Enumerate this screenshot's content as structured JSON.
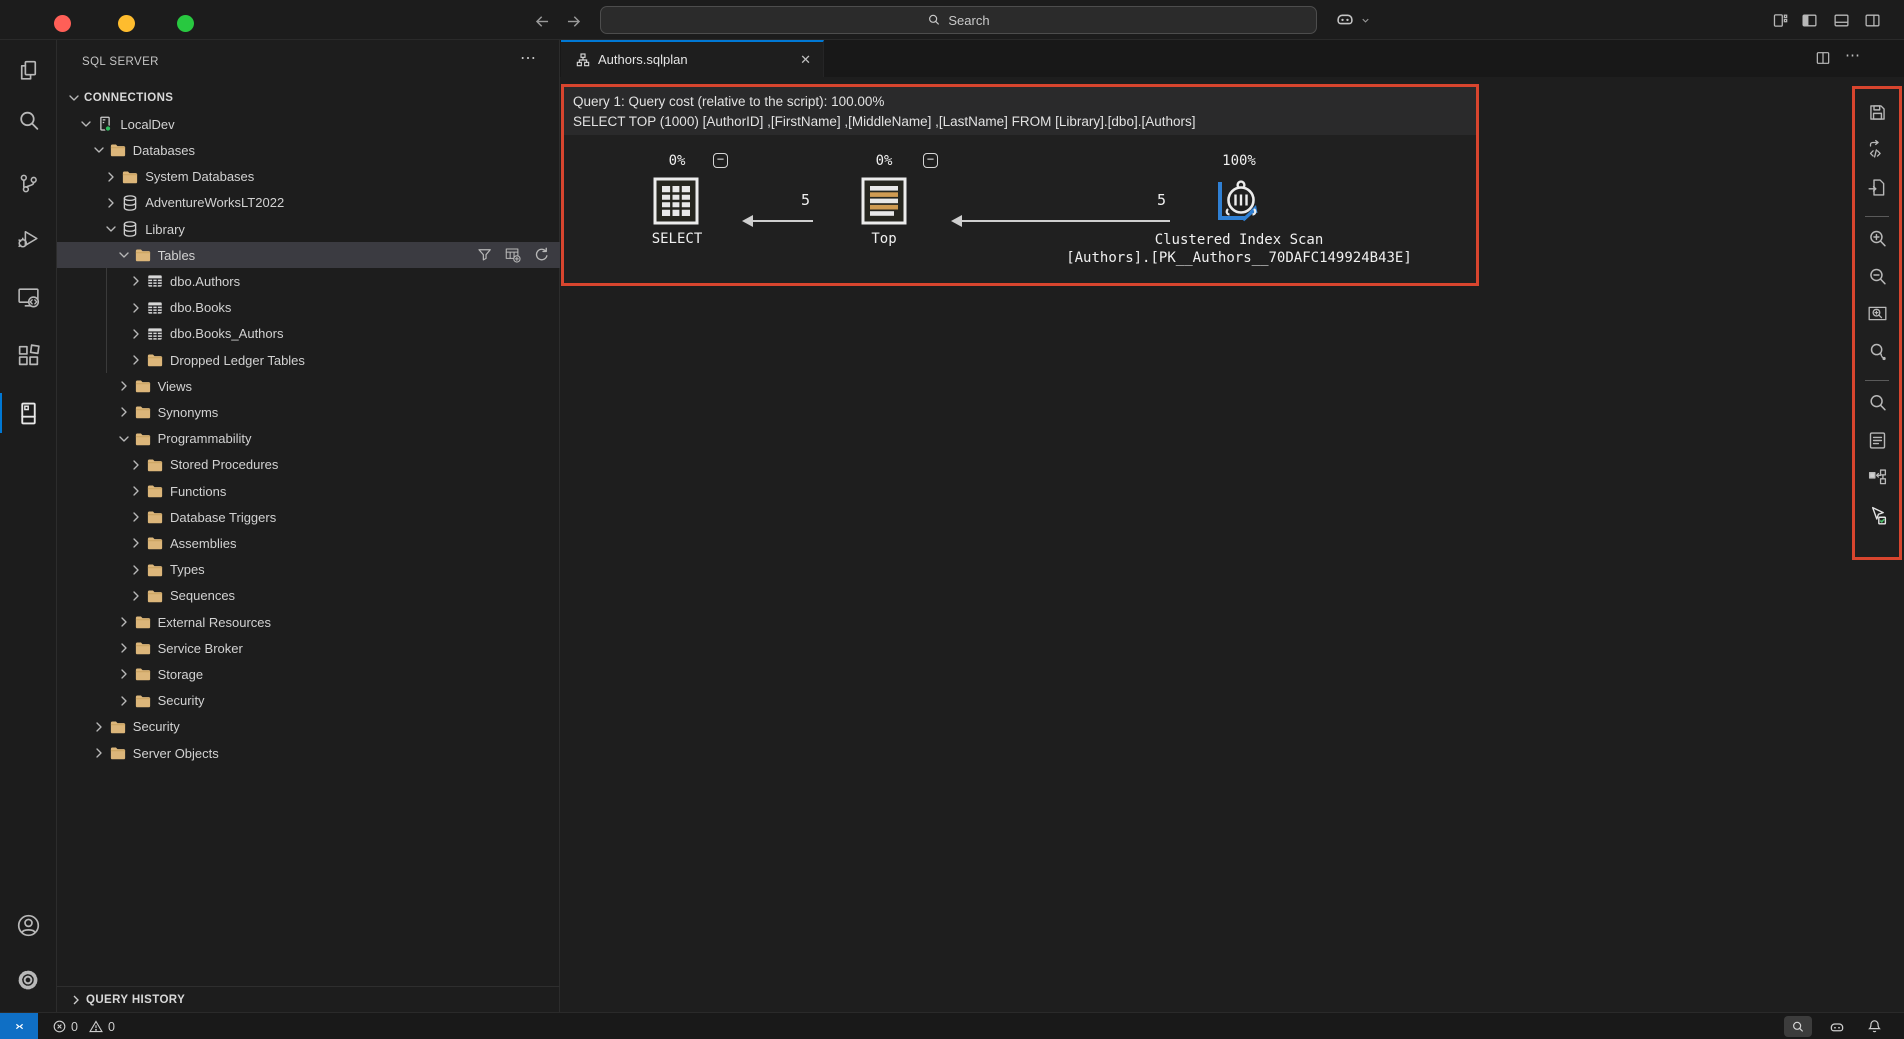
{
  "titlebar": {
    "search_placeholder": "Search",
    "traffic_lights": [
      "close",
      "minimize",
      "zoom"
    ],
    "right_icons": [
      "customize-layout",
      "toggle-primary-sidebar",
      "toggle-panel",
      "toggle-secondary-sidebar"
    ],
    "copilot_menu": "copilot"
  },
  "activity_bar": {
    "items": [
      "explorer",
      "search",
      "source-control",
      "run-and-debug",
      "remote-explorer",
      "extensions",
      "sql-server"
    ],
    "active_item": "sql-server",
    "bottom_items": [
      "accounts",
      "settings"
    ]
  },
  "sidebar": {
    "title": "SQL SERVER",
    "more_label": "⋯",
    "connections_header": "CONNECTIONS",
    "query_history_header": "QUERY HISTORY",
    "tree": [
      {
        "label": "CONNECTIONS",
        "level": 0,
        "chevron": "down",
        "icon": "",
        "header": true
      },
      {
        "label": "LocalDev",
        "level": 1,
        "chevron": "down",
        "icon": "server"
      },
      {
        "label": "Databases",
        "level": 2,
        "chevron": "down",
        "icon": "folder"
      },
      {
        "label": "System Databases",
        "level": 3,
        "chevron": "right",
        "icon": "folder"
      },
      {
        "label": "AdventureWorksLT2022",
        "level": 3,
        "chevron": "right",
        "icon": "database"
      },
      {
        "label": "Library",
        "level": 3,
        "chevron": "down",
        "icon": "database"
      },
      {
        "label": "Tables",
        "level": 4,
        "chevron": "down",
        "icon": "folder",
        "selected": true,
        "actions": [
          "filter",
          "design",
          "refresh"
        ]
      },
      {
        "label": "dbo.Authors",
        "level": 5,
        "chevron": "right",
        "icon": "table"
      },
      {
        "label": "dbo.Books",
        "level": 5,
        "chevron": "right",
        "icon": "table"
      },
      {
        "label": "dbo.Books_Authors",
        "level": 5,
        "chevron": "right",
        "icon": "table"
      },
      {
        "label": "Dropped Ledger Tables",
        "level": 5,
        "chevron": "right",
        "icon": "folder"
      },
      {
        "label": "Views",
        "level": 4,
        "chevron": "right",
        "icon": "folder"
      },
      {
        "label": "Synonyms",
        "level": 4,
        "chevron": "right",
        "icon": "folder"
      },
      {
        "label": "Programmability",
        "level": 4,
        "chevron": "down",
        "icon": "folder"
      },
      {
        "label": "Stored Procedures",
        "level": 5,
        "chevron": "right",
        "icon": "folder"
      },
      {
        "label": "Functions",
        "level": 5,
        "chevron": "right",
        "icon": "folder"
      },
      {
        "label": "Database Triggers",
        "level": 5,
        "chevron": "right",
        "icon": "folder"
      },
      {
        "label": "Assemblies",
        "level": 5,
        "chevron": "right",
        "icon": "folder"
      },
      {
        "label": "Types",
        "level": 5,
        "chevron": "right",
        "icon": "folder"
      },
      {
        "label": "Sequences",
        "level": 5,
        "chevron": "right",
        "icon": "folder"
      },
      {
        "label": "External Resources",
        "level": 4,
        "chevron": "right",
        "icon": "folder"
      },
      {
        "label": "Service Broker",
        "level": 4,
        "chevron": "right",
        "icon": "folder"
      },
      {
        "label": "Storage",
        "level": 4,
        "chevron": "right",
        "icon": "folder"
      },
      {
        "label": "Security",
        "level": 4,
        "chevron": "right",
        "icon": "folder"
      },
      {
        "label": "Security",
        "level": 2,
        "chevron": "right",
        "icon": "folder"
      },
      {
        "label": "Server Objects",
        "level": 2,
        "chevron": "right",
        "icon": "folder"
      }
    ]
  },
  "editor": {
    "tab": {
      "label": "Authors.sqlplan",
      "icon": "sqlplan-icon",
      "close": "✕"
    },
    "tabbar_actions": [
      "split-editor",
      "more-actions"
    ],
    "more_actions_label": "⋯"
  },
  "plan": {
    "header_line1": "Query 1: Query cost (relative to the script): 100.00%",
    "header_line2": "SELECT TOP (1000) [AuthorID] ,[FirstName] ,[MiddleName] ,[LastName] FROM [Library].[dbo].[Authors]",
    "nodes": [
      {
        "cost": "0%",
        "name": "SELECT",
        "collapse": "−"
      },
      {
        "cost": "0%",
        "name": "Top",
        "collapse": "−"
      },
      {
        "cost": "100%",
        "name": "Clustered Index Scan",
        "detail": "[Authors].[PK__Authors__70DAFC149924B43E]"
      }
    ],
    "edges": [
      {
        "rows": "5"
      },
      {
        "rows": "5"
      }
    ],
    "toolbar": [
      "save-plan",
      "show-query-xml",
      "open-query",
      "divider",
      "zoom-in",
      "zoom-out",
      "zoom-to-fit",
      "custom-zoom",
      "divider",
      "find-node",
      "properties",
      "highlight-expensive-operation",
      "toggle-tooltips"
    ]
  },
  "statusbar": {
    "errors": "0",
    "warnings": "0",
    "right_icons": [
      "search",
      "copilot",
      "bell"
    ]
  },
  "colors": {
    "highlight_red": "#d8452e",
    "accent_blue": "#0078d4",
    "remote_blue": "#0f6fc5",
    "folder_tan": "#dcb67a",
    "top_node_bar": "#cf9b52",
    "scan_blue": "#2f80d4",
    "server_green": "#2fbe60",
    "traffic_red": "#ff5f57",
    "traffic_yellow": "#febc2e",
    "traffic_green": "#28c840"
  }
}
